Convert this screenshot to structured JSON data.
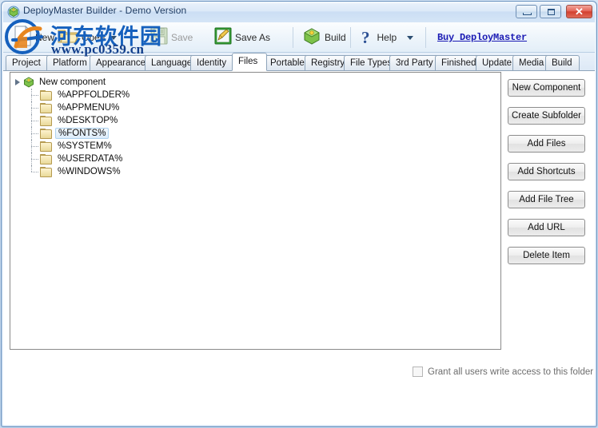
{
  "window": {
    "title": "DeployMaster Builder - Demo Version",
    "app_icon": "cube-icon",
    "controls": {
      "minimize": "minimize-button",
      "maximize": "maximize-button",
      "close_glyph": "✕"
    }
  },
  "toolbar": {
    "items": [
      {
        "label": "New",
        "icon": "new-document-icon",
        "disabled": false,
        "dropdown": false
      },
      {
        "label": "Open",
        "icon": "open-folder-icon",
        "disabled": false,
        "dropdown": true
      },
      {
        "label": "Save",
        "icon": "save-disk-icon",
        "disabled": true,
        "dropdown": false
      },
      {
        "label": "Save As",
        "icon": "save-as-icon",
        "disabled": false,
        "dropdown": false
      },
      {
        "label": "Build",
        "icon": "build-cube-icon",
        "disabled": false,
        "dropdown": false
      },
      {
        "label": "Help",
        "icon": "help-question-icon",
        "disabled": false,
        "dropdown": true
      }
    ],
    "buy_link": "Buy DeployMaster",
    "buy_link_color": "#1a1ab4"
  },
  "tabs": {
    "active": "Files",
    "items": [
      "Project",
      "Platform",
      "Appearance",
      "Language",
      "Identity",
      "Files",
      "Portable",
      "Registry",
      "File Types",
      "3rd Party",
      "Finished",
      "Update",
      "Media",
      "Build"
    ]
  },
  "tree": {
    "root": {
      "label": "New component",
      "icon": "component-cube-icon",
      "expanded": true
    },
    "selected": "%FONTS%",
    "children": [
      {
        "label": "%APPFOLDER%",
        "icon": "folder-icon"
      },
      {
        "label": "%APPMENU%",
        "icon": "folder-icon"
      },
      {
        "label": "%DESKTOP%",
        "icon": "folder-icon"
      },
      {
        "label": "%FONTS%",
        "icon": "folder-icon"
      },
      {
        "label": "%SYSTEM%",
        "icon": "folder-icon"
      },
      {
        "label": "%USERDATA%",
        "icon": "folder-icon"
      },
      {
        "label": "%WINDOWS%",
        "icon": "folder-icon"
      }
    ]
  },
  "side_buttons": [
    "New Component",
    "Create Subfolder",
    "Add Files",
    "Add Shortcuts",
    "Add File Tree",
    "Add URL",
    "Delete Item"
  ],
  "options": {
    "grant_access": {
      "label": "Grant all users write access to this folder",
      "checked": false,
      "enabled": false
    }
  },
  "watermark": {
    "site_name": "河东软件园",
    "url": "www.pc0359.cn",
    "accent": "#1560bd"
  }
}
